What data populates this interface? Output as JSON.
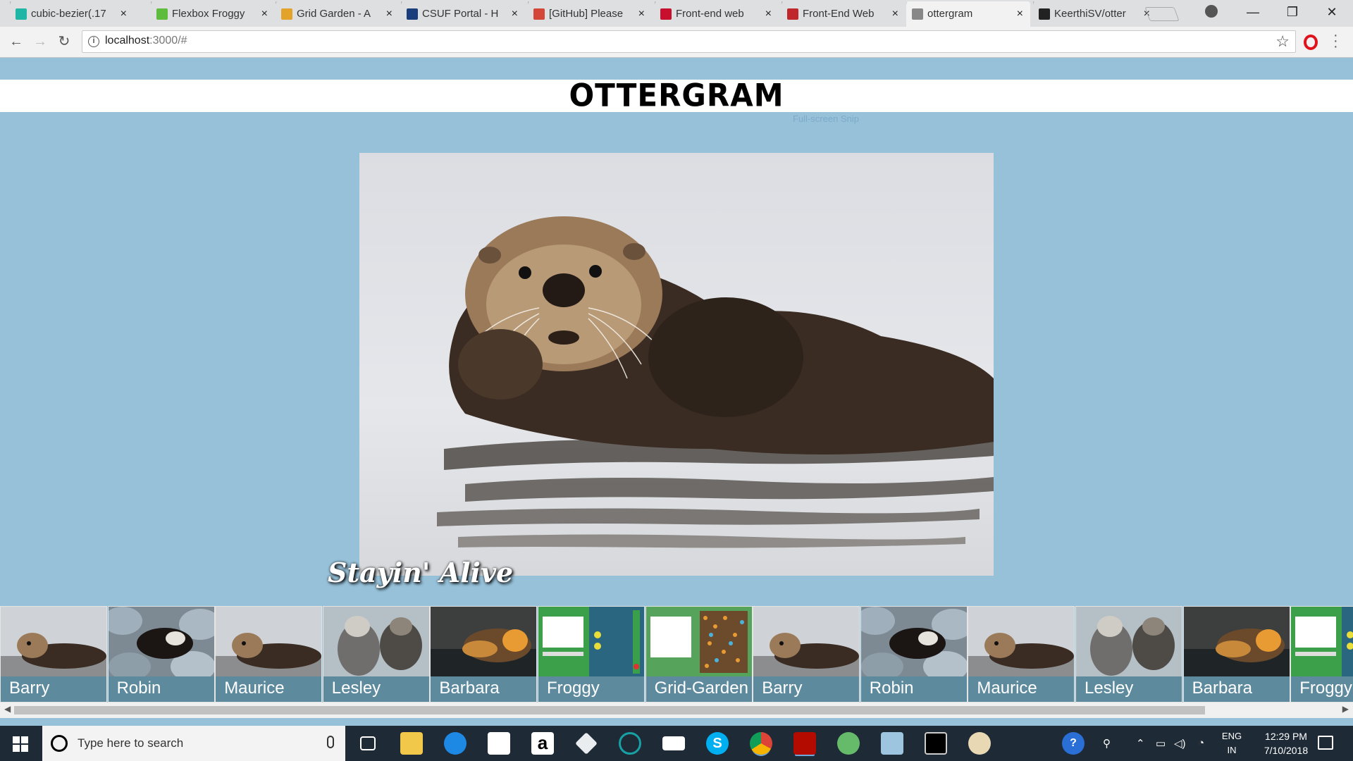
{
  "browser": {
    "tabs": [
      {
        "title": "cubic-bezier(.17",
        "favicon": "cubic-bezier-icon",
        "color": "#1fb6a6"
      },
      {
        "title": "Flexbox Froggy",
        "favicon": "froggy-icon",
        "color": "#5dbb3d"
      },
      {
        "title": "Grid Garden - A",
        "favicon": "carrot-icon",
        "color": "#e3a229"
      },
      {
        "title": "CSUF Portal - H",
        "favicon": "portal-icon",
        "color": "#1a3d7c"
      },
      {
        "title": "[GitHub] Please",
        "favicon": "gmail-icon",
        "color": "#d44638"
      },
      {
        "title": "Front-end web",
        "favicon": "csu-icon",
        "color": "#c8102e"
      },
      {
        "title": "Front-End Web",
        "favicon": "dr-icon",
        "color": "#c0272d"
      },
      {
        "title": "ottergram",
        "favicon": "page-icon",
        "color": "#888888"
      },
      {
        "title": "KeerthiSV/otter",
        "favicon": "github-icon",
        "color": "#222222"
      }
    ],
    "active_tab": 7,
    "url_host": "localhost",
    "url_rest": ":3000/#",
    "info_glyph": "i",
    "back_glyph": "←",
    "forward_glyph": "→",
    "reload_glyph": "↻",
    "star_glyph": "☆",
    "min_glyph": "—",
    "max_glyph": "❐",
    "close_glyph": "✕",
    "tab_close_glyph": "×"
  },
  "page": {
    "logo": "OTTERGRAM",
    "snip_overlay": "Full-screen Snip",
    "detail_title": "Stayin' Alive",
    "background": "#96c1d9",
    "thumbnails": [
      {
        "name": "Barry",
        "kind": "otter-floating"
      },
      {
        "name": "Robin",
        "kind": "otter-rocks"
      },
      {
        "name": "Maurice",
        "kind": "otter-floating"
      },
      {
        "name": "Lesley",
        "kind": "otter-pair"
      },
      {
        "name": "Barbara",
        "kind": "otter-orange"
      },
      {
        "name": "Froggy",
        "kind": "froggy-screenshot"
      },
      {
        "name": "Grid-Garden",
        "kind": "garden-screenshot"
      },
      {
        "name": "Barry",
        "kind": "otter-floating"
      },
      {
        "name": "Robin",
        "kind": "otter-rocks"
      },
      {
        "name": "Maurice",
        "kind": "otter-floating"
      },
      {
        "name": "Lesley",
        "kind": "otter-pair"
      },
      {
        "name": "Barbara",
        "kind": "otter-orange"
      },
      {
        "name": "Froggy",
        "kind": "froggy-screenshot"
      }
    ]
  },
  "taskbar": {
    "search_placeholder": "Type here to search",
    "apps": [
      "task-view-icon",
      "file-explorer-icon",
      "edge-icon",
      "store-icon",
      "amazon-icon",
      "dropbox-icon",
      "arduino-icon",
      "mail-icon",
      "skype-icon",
      "chrome-icon",
      "acrobat-icon",
      "atom-icon",
      "notepad-icon",
      "terminal-icon",
      "paint-icon"
    ],
    "amazon_glyph": "a",
    "skype_glyph": "S",
    "help_glyph": "?",
    "lang_1": "ENG",
    "lang_2": "IN",
    "time": "12:29 PM",
    "date": "7/10/2018"
  }
}
